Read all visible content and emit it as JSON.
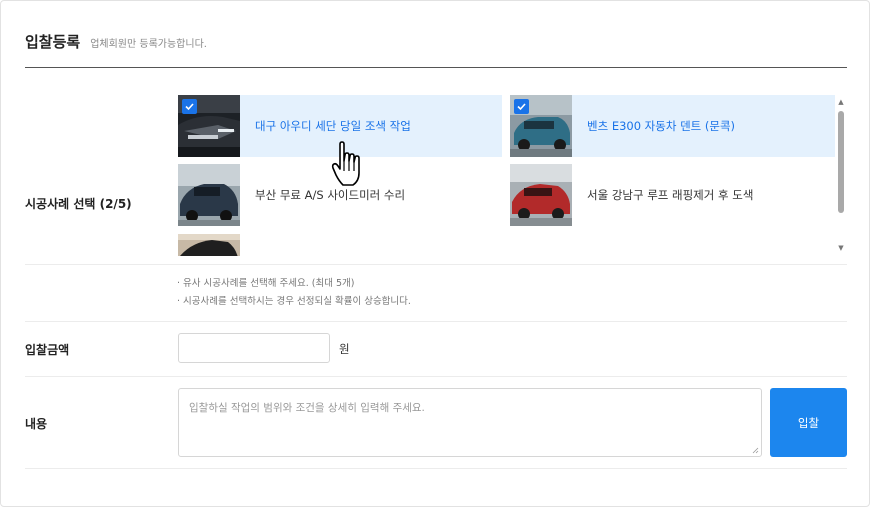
{
  "header": {
    "title": "입찰등록",
    "subtitle": "업체회원만 등록가능합니다."
  },
  "cases": {
    "label": "시공사례 선택 (2/5)",
    "items": [
      {
        "label": "대구 아우디 세단 당일 조색 작업",
        "selected": true
      },
      {
        "label": "벤츠 E300 자동차 덴트 (문콕)",
        "selected": true
      },
      {
        "label": "부산 무료 A/S 사이드미러 수리",
        "selected": false
      },
      {
        "label": "서울 강남구 루프 래핑제거 후 도색",
        "selected": false
      }
    ],
    "notes": [
      "· 유사 시공사례를 선택해 주세요. (최대 5개)",
      "· 시공사례를 선택하시는 경우 선정되실 확률이 상승합니다."
    ]
  },
  "amount": {
    "label": "입찰금액",
    "value": "",
    "unit": "원"
  },
  "content": {
    "label": "내용",
    "placeholder": "입찰하실 작업의 범위와 조건을 상세히 입력해 주세요."
  },
  "submit": {
    "label": "입찰"
  },
  "colors": {
    "accent": "#1c86ee",
    "selected_bg": "#e4f1fd",
    "selected_text": "#1a73e8"
  }
}
